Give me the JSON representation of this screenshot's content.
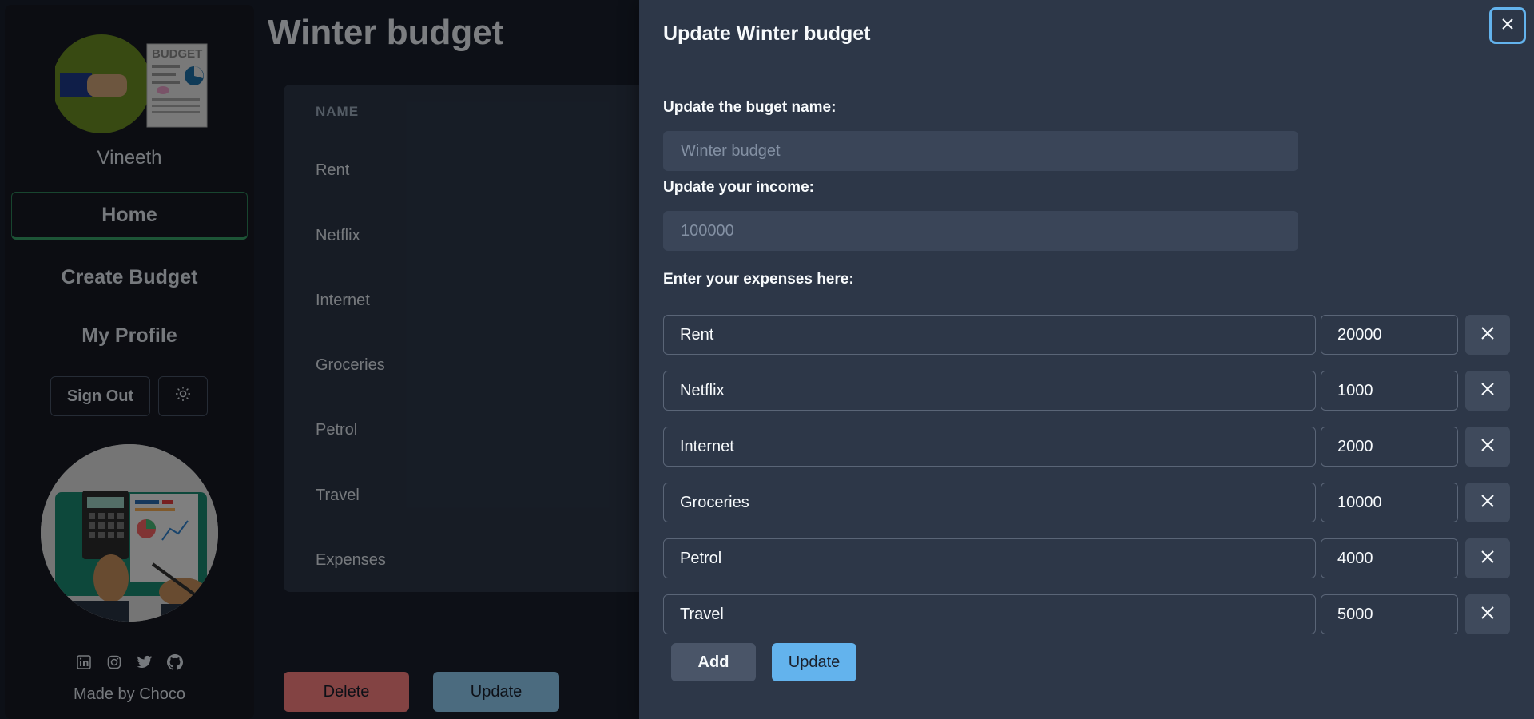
{
  "sidebar": {
    "user_name": "Vineeth",
    "nav": {
      "home": "Home",
      "create": "Create Budget",
      "profile": "My Profile"
    },
    "sign_out": "Sign Out",
    "made_by": "Made by Choco",
    "logo_text": "BUDGET"
  },
  "page": {
    "title": "Winter budget",
    "table_header": "NAME",
    "rows": [
      "Rent",
      "Netflix",
      "Internet",
      "Groceries",
      "Petrol",
      "Travel",
      "Expenses"
    ],
    "delete_label": "Delete",
    "update_label": "Update"
  },
  "drawer": {
    "title": "Update Winter budget",
    "name_label": "Update the buget name:",
    "name_placeholder": "Winter budget",
    "income_label": "Update your income:",
    "income_placeholder": "100000",
    "expenses_label": "Enter your expenses here:",
    "expenses": [
      {
        "name": "Rent",
        "amount": "20000"
      },
      {
        "name": "Netflix",
        "amount": "1000"
      },
      {
        "name": "Internet",
        "amount": "2000"
      },
      {
        "name": "Groceries",
        "amount": "10000"
      },
      {
        "name": "Petrol",
        "amount": "4000"
      },
      {
        "name": "Travel",
        "amount": "5000"
      }
    ],
    "add_label": "Add",
    "update_label": "Update"
  },
  "colors": {
    "accent": "#63b3ed",
    "danger": "#fc8181",
    "success": "#38a169"
  }
}
